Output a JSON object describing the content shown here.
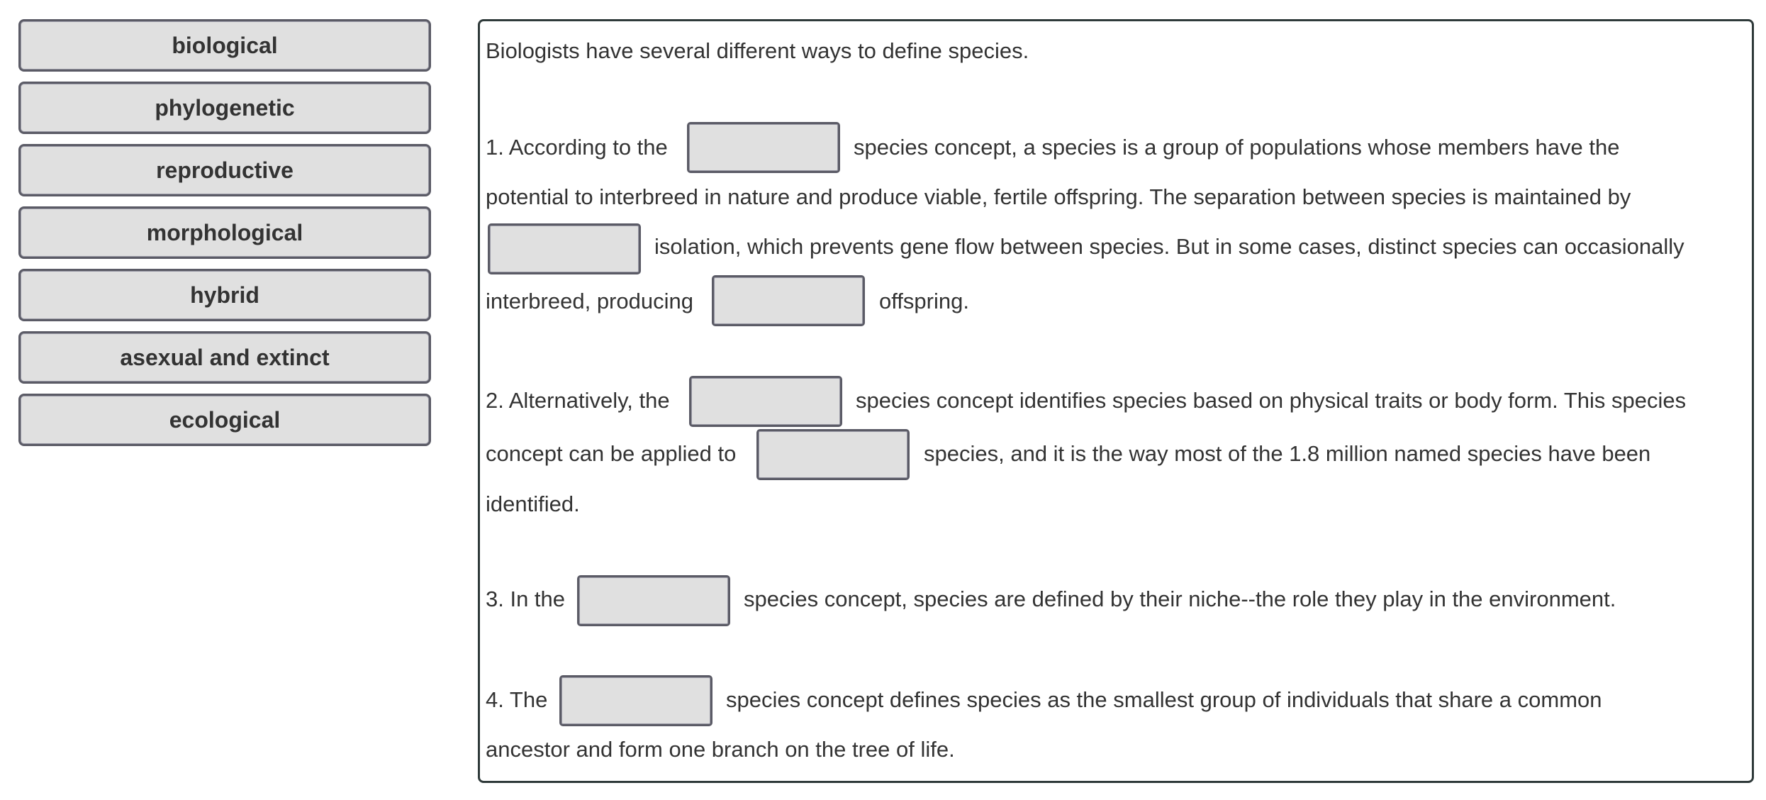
{
  "word_bank": {
    "items": [
      {
        "label": "biological"
      },
      {
        "label": "phylogenetic"
      },
      {
        "label": "reproductive"
      },
      {
        "label": "morphological"
      },
      {
        "label": "hybrid"
      },
      {
        "label": "asexual and extinct"
      },
      {
        "label": "ecological"
      }
    ]
  },
  "passage": {
    "intro": "Biologists have several different ways to define species.",
    "p1": {
      "l1_a": "1. According to the",
      "l1_b": "species concept, a species is a group of populations whose members have the",
      "l2": "potential to interbreed in nature and produce viable, fertile offspring. The separation between species is maintained by",
      "l3": "isolation, which prevents gene flow between species. But in some cases, distinct species can occasionally",
      "l4_a": "interbreed, producing",
      "l4_b": "offspring."
    },
    "p2": {
      "l1_a": "2. Alternatively, the",
      "l1_b": "species concept identifies species based on physical traits or body form. This species",
      "l2_a": "concept can be applied to",
      "l2_b": "species, and it is the way most of the 1.8 million named species have been",
      "l3": "identified."
    },
    "p3": {
      "l1_a": "3. In the",
      "l1_b": "species concept, species are defined by their niche--the role they play in the environment."
    },
    "p4": {
      "l1_a": "4. The",
      "l1_b": "species concept defines species as the smallest group of individuals that share a common",
      "l2": "ancestor and form one branch on the tree of life."
    }
  },
  "drop_zones": [
    {
      "id": "blank-1",
      "value": ""
    },
    {
      "id": "blank-2",
      "value": ""
    },
    {
      "id": "blank-3",
      "value": ""
    },
    {
      "id": "blank-4",
      "value": ""
    },
    {
      "id": "blank-5",
      "value": ""
    },
    {
      "id": "blank-6",
      "value": ""
    },
    {
      "id": "blank-7",
      "value": ""
    }
  ],
  "colors": {
    "tile_fill": "#e0e0e0",
    "tile_border": "#5b5b66",
    "panel_border": "#2f3a3a",
    "text": "#333333"
  }
}
